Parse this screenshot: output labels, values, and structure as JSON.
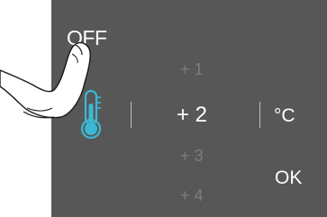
{
  "power": {
    "label": "OFF"
  },
  "levels": [
    "+ 1",
    "+ 2",
    "+ 3",
    "+ 4"
  ],
  "selected_level": "+ 2",
  "unit": {
    "label": "°C"
  },
  "confirm": {
    "label": "OK"
  },
  "icons": {
    "thermometer": "thermometer-icon",
    "pointer_hand": "pointing-hand-icon"
  },
  "colors": {
    "panel": "#575757",
    "text_active": "#ffffff",
    "text_inactive": "#7c7c7c",
    "thermometer_accent": "#3bb8d4"
  }
}
